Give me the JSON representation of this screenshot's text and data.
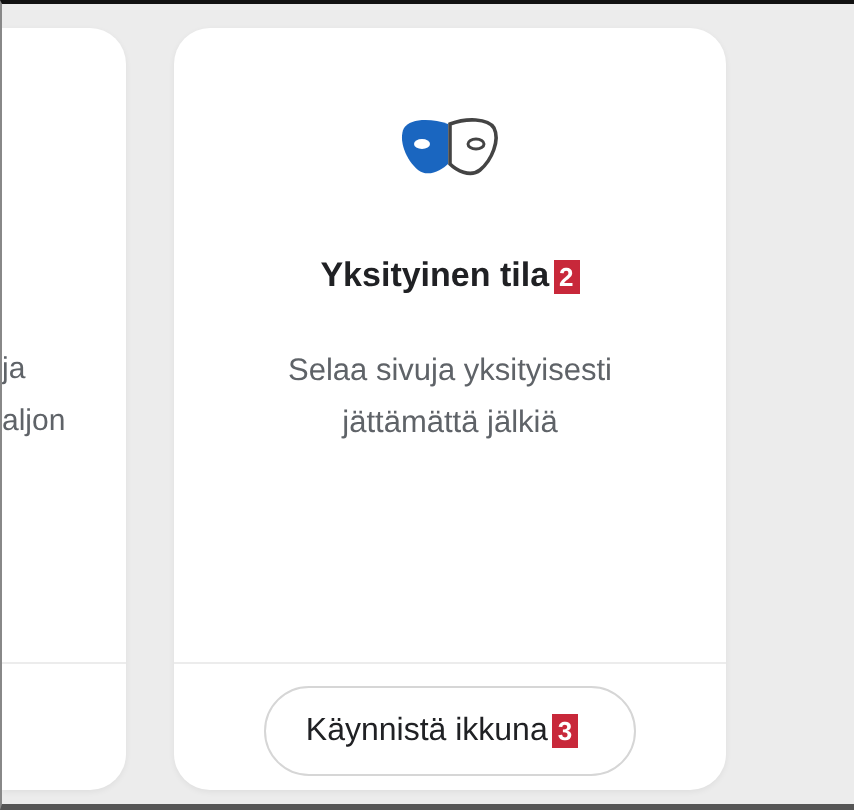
{
  "left_card": {
    "description_lines": [
      "ja",
      "aljon"
    ]
  },
  "card": {
    "title": "Yksityinen tila",
    "title_badge": "2",
    "description": "Selaa sivuja yksityisesti jättämättä jälkiä",
    "button": {
      "label": "Käynnistä ikkuna",
      "badge": "3"
    }
  }
}
